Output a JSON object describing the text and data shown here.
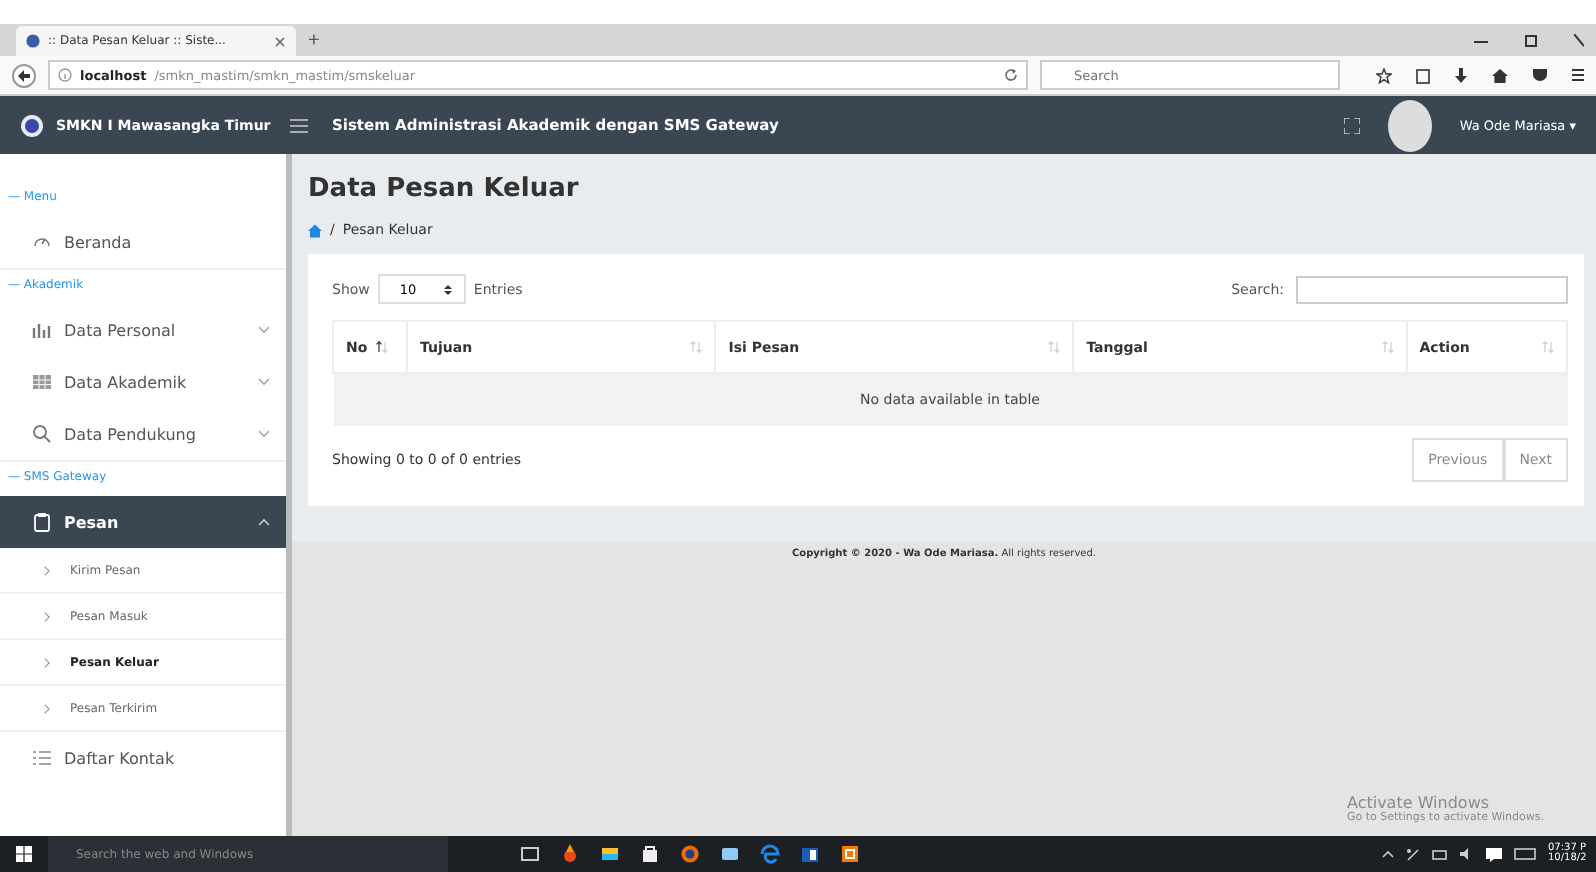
{
  "browser": {
    "tab_title": ":: Data Pesan Keluar :: Siste...",
    "new_tab": "+",
    "url_host": "localhost",
    "url_path": "/smkn_mastim/smkn_mastim/smskeluar",
    "search_placeholder": "Search"
  },
  "header": {
    "brand": "SMKN I Mawasangka Timur",
    "title": "Sistem Administrasi Akademik dengan SMS Gateway",
    "user": "Wa Ode Mariasa",
    "user_caret": "▾"
  },
  "sidebar": {
    "items": [
      {
        "kind": "heading",
        "label": "— Menu"
      },
      {
        "kind": "item",
        "label": "Beranda",
        "expandable": false,
        "expanded": false
      },
      {
        "kind": "heading",
        "label": "— Akademik"
      },
      {
        "kind": "item",
        "label": "Data Personal",
        "expandable": true,
        "expanded": false
      },
      {
        "kind": "item",
        "label": "Data Akademik",
        "expandable": true,
        "expanded": false
      },
      {
        "kind": "item",
        "label": "Data Pendukung",
        "expandable": true,
        "expanded": false
      },
      {
        "kind": "heading",
        "label": "— SMS Gateway"
      },
      {
        "kind": "item",
        "label": "Pesan",
        "expandable": true,
        "expanded": true,
        "children": [
          {
            "label": "Kirim Pesan",
            "selected": false
          },
          {
            "label": "Pesan Masuk",
            "selected": false
          },
          {
            "label": "Pesan Keluar",
            "selected": true
          },
          {
            "label": "Pesan Terkirim",
            "selected": false
          }
        ]
      },
      {
        "kind": "item",
        "label": "Daftar Kontak",
        "expandable": false,
        "expanded": false
      }
    ]
  },
  "main": {
    "page_title": "Data Pesan Keluar",
    "breadcrumb_separator": "/",
    "breadcrumb": "Pesan Keluar",
    "table": {
      "show_label": "Show",
      "page_size": "10",
      "entries_label": "Entries",
      "search_label": "Search:",
      "columns": [
        {
          "label": "No",
          "sorted": true
        },
        {
          "label": "Tujuan",
          "sorted": false
        },
        {
          "label": "Isi Pesan",
          "sorted": false
        },
        {
          "label": "Tanggal",
          "sorted": false
        },
        {
          "label": "Action",
          "sorted": false
        }
      ],
      "empty_message": "No data available in table",
      "info": "Showing 0 to 0 of 0 entries",
      "pagination": [
        {
          "label": "Previous",
          "disabled": true
        },
        {
          "label": "Next",
          "disabled": true
        }
      ]
    }
  },
  "footer": {
    "copyright": "**Copyright © 2020 - Wa Ode Mariasa.** All rights reserved."
  },
  "activation_notice": {
    "title": "Activate Windows",
    "subtitle": "Go to Settings to activate Windows."
  },
  "taskbar": {
    "search_placeholder": "Search the web and Windows",
    "time": "07:37 P",
    "date": "10/18/2"
  }
}
